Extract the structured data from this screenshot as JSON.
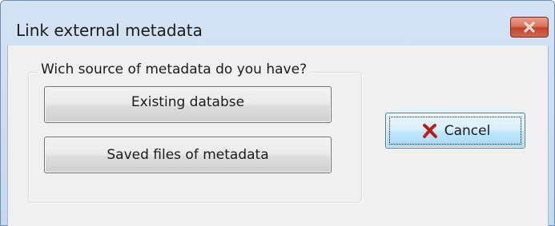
{
  "window": {
    "title": "Link external metadata"
  },
  "group": {
    "label": "Wich source of metadata do you have?",
    "options": [
      {
        "label": "Existing databse"
      },
      {
        "label": "Saved files of metadata"
      }
    ]
  },
  "actions": {
    "cancel_label": "Cancel",
    "cancel_icon": "red-x-icon"
  },
  "colors": {
    "close_button": "#c4412a",
    "cancel_icon": "#c0201a",
    "focus_border": "#3c7fb1"
  }
}
